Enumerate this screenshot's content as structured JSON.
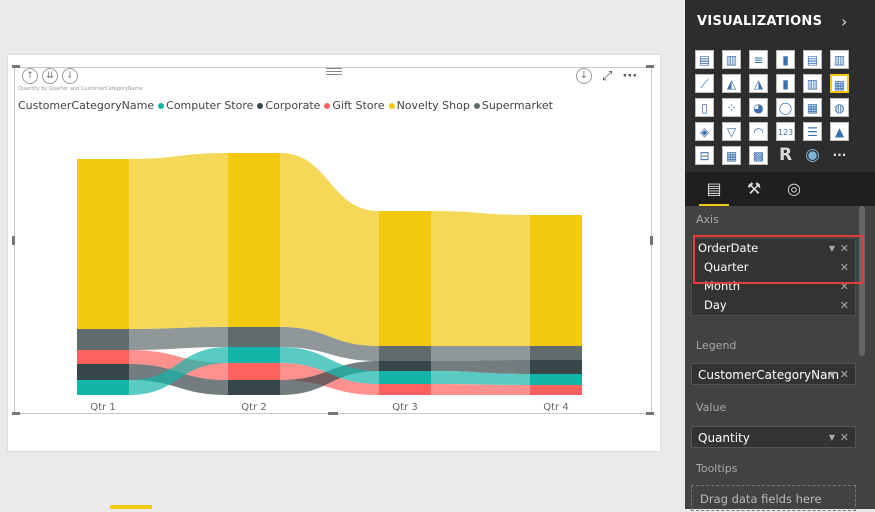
{
  "visual": {
    "small_title": "Quantity by Quarter and CustomerCategoryName",
    "header_icons": [
      "drill-up-icon",
      "expand-all-icon",
      "drill-down-icon"
    ],
    "legend": {
      "title": "CustomerCategoryName",
      "items": [
        {
          "label": "Computer Store",
          "color": "#12b5a8"
        },
        {
          "label": "Corporate",
          "color": "#374649"
        },
        {
          "label": "Gift Store",
          "color": "#fd625e"
        },
        {
          "label": "Novelty Shop",
          "color": "#f2c811"
        },
        {
          "label": "Supermarket",
          "color": "#5f6b6d"
        }
      ]
    }
  },
  "chart_data": {
    "type": "area",
    "subtype": "ribbon",
    "categories": [
      "Qtr 1",
      "Qtr 2",
      "Qtr 3",
      "Qtr 4"
    ],
    "series": [
      {
        "name": "Novelty Shop",
        "color": "#f2c811",
        "values": [
          170,
          174,
          135,
          131
        ]
      },
      {
        "name": "Supermarket",
        "color": "#5f6b6d",
        "values": [
          21,
          20,
          15,
          14
        ]
      },
      {
        "name": "Gift Store",
        "color": "#fd625e",
        "values": [
          14,
          17,
          11,
          10
        ]
      },
      {
        "name": "Corporate",
        "color": "#374649",
        "values": [
          16,
          15,
          10,
          14
        ]
      },
      {
        "name": "Computer Store",
        "color": "#12b5a8",
        "values": [
          15,
          16,
          13,
          11
        ]
      }
    ],
    "order_per_category": [
      [
        "Novelty Shop",
        "Supermarket",
        "Gift Store",
        "Corporate",
        "Computer Store"
      ],
      [
        "Novelty Shop",
        "Supermarket",
        "Computer Store",
        "Gift Store",
        "Corporate"
      ],
      [
        "Novelty Shop",
        "Supermarket",
        "Corporate",
        "Computer Store",
        "Gift Store"
      ],
      [
        "Novelty Shop",
        "Supermarket",
        "Corporate",
        "Computer Store",
        "Gift Store"
      ]
    ],
    "legend_position": "top-left",
    "grid": false
  },
  "pane": {
    "title": "VISUALIZATIONS",
    "sections": {
      "axis": "Axis",
      "legend": "Legend",
      "value": "Value",
      "tooltips": "Tooltips"
    },
    "axis_fields": [
      "OrderDate",
      "Quarter",
      "Month",
      "Day"
    ],
    "legend_field": "CustomerCategoryNam",
    "value_field": "Quantity",
    "tooltip_placeholder": "Drag data fields here"
  }
}
